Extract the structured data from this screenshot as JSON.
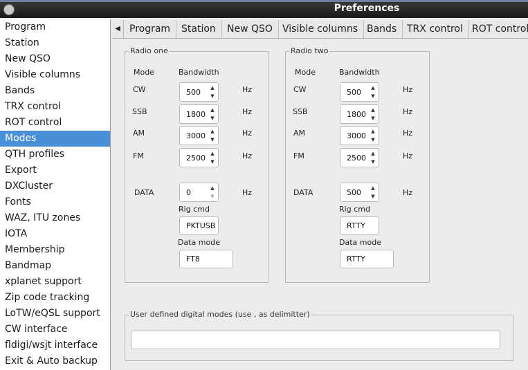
{
  "window": {
    "title": "Preferences"
  },
  "sidebar": {
    "items": [
      {
        "label": "Program"
      },
      {
        "label": "Station"
      },
      {
        "label": "New QSO"
      },
      {
        "label": "Visible columns"
      },
      {
        "label": "Bands"
      },
      {
        "label": "TRX control"
      },
      {
        "label": "ROT control"
      },
      {
        "label": "Modes"
      },
      {
        "label": "QTH profiles"
      },
      {
        "label": "Export"
      },
      {
        "label": "DXCluster"
      },
      {
        "label": "Fonts"
      },
      {
        "label": "WAZ, ITU zones"
      },
      {
        "label": "IOTA"
      },
      {
        "label": "Membership"
      },
      {
        "label": "Bandmap"
      },
      {
        "label": "xplanet support"
      },
      {
        "label": "Zip code tracking"
      },
      {
        "label": "LoTW/eQSL support"
      },
      {
        "label": "CW interface"
      },
      {
        "label": "fldigi/wsjt interface"
      },
      {
        "label": "Exit & Auto backup"
      }
    ],
    "selected": "Modes"
  },
  "tabs": {
    "scroll_left_icon": "triangle-left-icon",
    "items": [
      "Program",
      "Station",
      "New QSO",
      "Visible columns",
      "Bands",
      "TRX control",
      "ROT control"
    ]
  },
  "modes": {
    "radio_one": {
      "title": "Radio one",
      "mode_header": "Mode",
      "bandwidth_header": "Bandwidth",
      "rows": [
        {
          "mode": "CW",
          "value": "500",
          "unit": "Hz"
        },
        {
          "mode": "SSB",
          "value": "1800",
          "unit": "Hz"
        },
        {
          "mode": "AM",
          "value": "3000",
          "unit": "Hz"
        },
        {
          "mode": "FM",
          "value": "2500",
          "unit": "Hz"
        },
        {
          "mode": "DATA",
          "value": "0",
          "unit": "Hz"
        }
      ],
      "rig_cmd_label": "Rig cmd",
      "rig_cmd": "PKTUSB",
      "data_mode_label": "Data mode",
      "data_mode": "FT8"
    },
    "radio_two": {
      "title": "Radio two",
      "mode_header": "Mode",
      "bandwidth_header": "Bandwidth",
      "rows": [
        {
          "mode": "CW",
          "value": "500",
          "unit": "Hz"
        },
        {
          "mode": "SSB",
          "value": "1800",
          "unit": "Hz"
        },
        {
          "mode": "AM",
          "value": "3000",
          "unit": "Hz"
        },
        {
          "mode": "FM",
          "value": "2500",
          "unit": "Hz"
        },
        {
          "mode": "DATA",
          "value": "500",
          "unit": "Hz"
        }
      ],
      "rig_cmd_label": "Rig cmd",
      "rig_cmd": "RTTY",
      "data_mode_label": "Data mode",
      "data_mode": "RTTY"
    },
    "user_defined": {
      "title": "User defined digital modes (use , as delimitter)",
      "value": ""
    }
  },
  "colors": {
    "selection": "#4a90d9",
    "titlebar": "#1f1f1f"
  }
}
